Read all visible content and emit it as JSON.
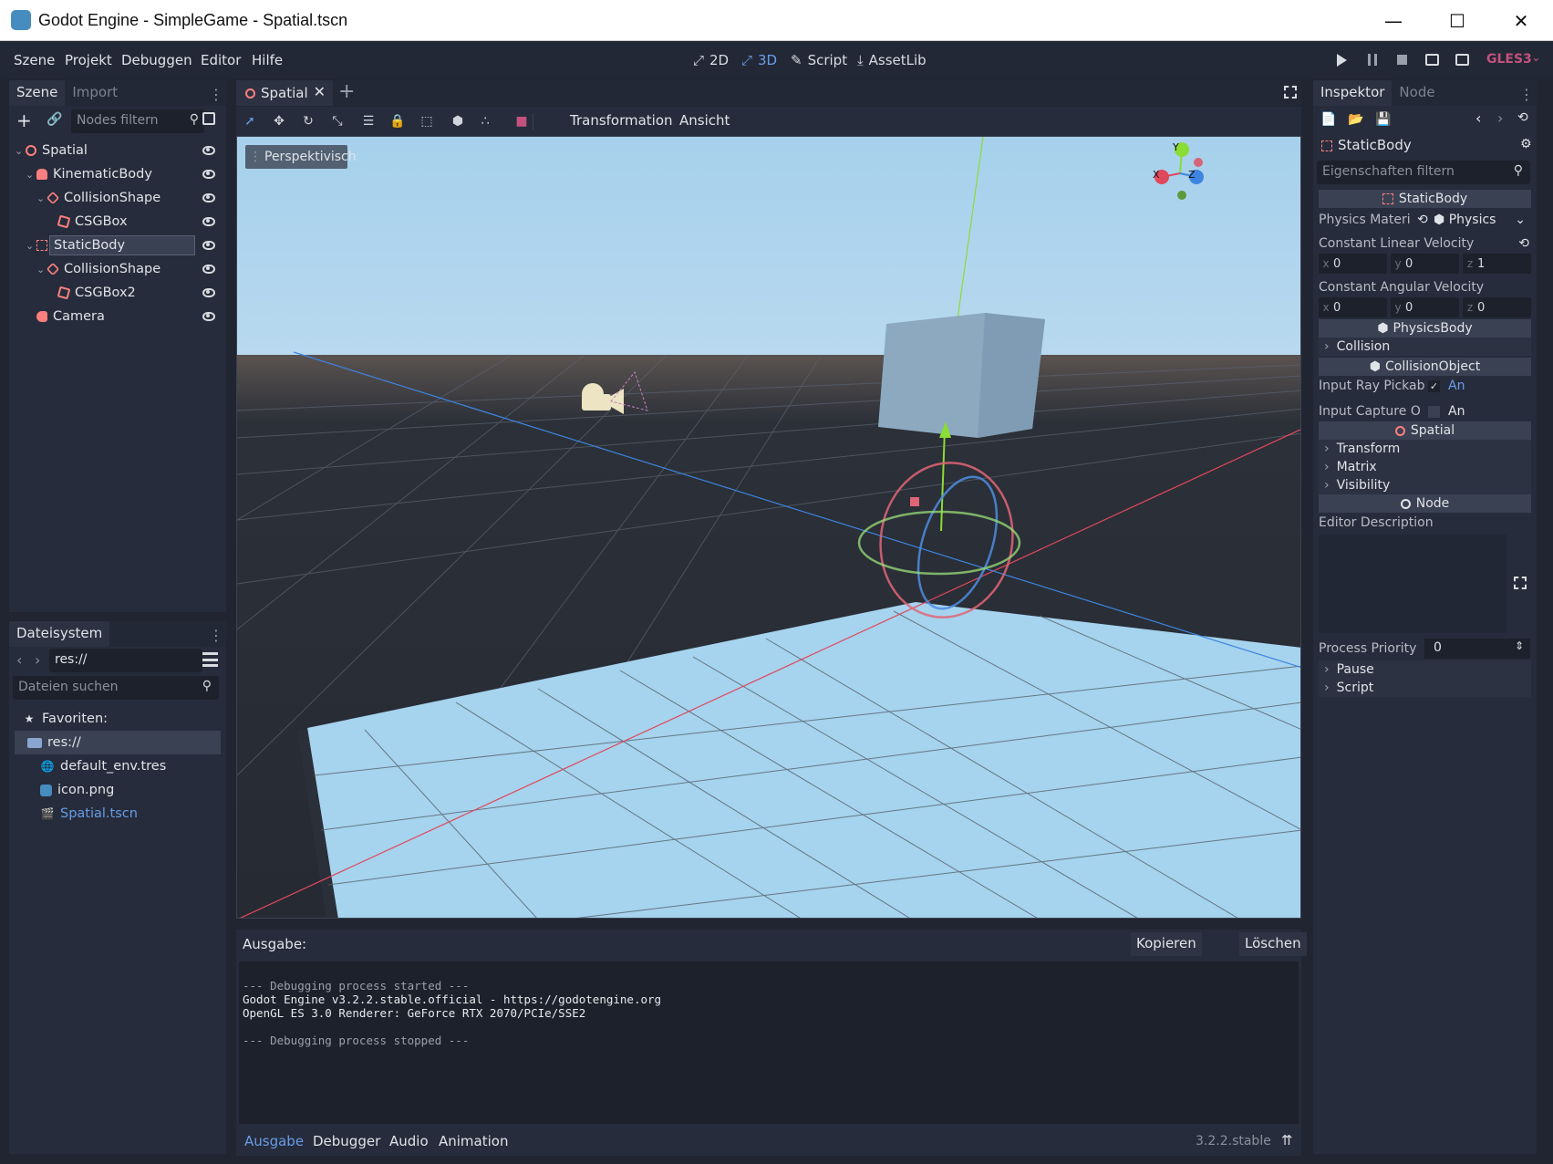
{
  "window": {
    "title": "Godot Engine - SimpleGame - Spatial.tscn",
    "min": "—",
    "max": "☐",
    "close": "✕"
  },
  "menu": [
    "Szene",
    "Projekt",
    "Debuggen",
    "Editor",
    "Hilfe"
  ],
  "workspaces": [
    {
      "label": "2D",
      "icon": "⤢"
    },
    {
      "label": "3D",
      "icon": "⤢"
    },
    {
      "label": "Script",
      "icon": "✎"
    },
    {
      "label": "AssetLib",
      "icon": "⤓"
    }
  ],
  "renderer": "GLES3",
  "scene_panel": {
    "tabs": [
      "Szene",
      "Import"
    ],
    "filter_placeholder": "Nodes filtern",
    "tree": [
      {
        "label": "Spatial",
        "indent": 0,
        "icon": "ring",
        "arrow": "⌄"
      },
      {
        "label": "KinematicBody",
        "indent": 1,
        "icon": "kin",
        "arrow": "⌄"
      },
      {
        "label": "CollisionShape",
        "indent": 2,
        "icon": "hex",
        "arrow": "⌄"
      },
      {
        "label": "CSGBox",
        "indent": 3,
        "icon": "csg",
        "arrow": ""
      },
      {
        "label": "StaticBody",
        "indent": 1,
        "icon": "box",
        "arrow": "⌄",
        "selected": true
      },
      {
        "label": "CollisionShape",
        "indent": 2,
        "icon": "hex",
        "arrow": "⌄"
      },
      {
        "label": "CSGBox2",
        "indent": 3,
        "icon": "csg",
        "arrow": ""
      },
      {
        "label": "Camera",
        "indent": 1,
        "icon": "cam",
        "arrow": ""
      }
    ]
  },
  "filesystem": {
    "tab": "Dateisystem",
    "path": "res://",
    "search_placeholder": "Dateien suchen",
    "items": [
      {
        "label": "Favoriten:",
        "indent": 0,
        "icon": "★"
      },
      {
        "label": "res://",
        "indent": 0,
        "icon": "folder",
        "selected": true
      },
      {
        "label": "default_env.tres",
        "indent": 1,
        "icon": "🌐"
      },
      {
        "label": "icon.png",
        "indent": 1,
        "icon": "img"
      },
      {
        "label": "Spatial.tscn",
        "indent": 1,
        "icon": "🎬",
        "link": true
      }
    ]
  },
  "editor": {
    "scene_tab": "Spatial",
    "toolbar_menus": [
      "Transformation",
      "Ansicht"
    ],
    "viewport_label": "Perspektivisch",
    "gizmo": {
      "y": "Y",
      "x": "X",
      "z": "Z"
    }
  },
  "output": {
    "title": "Ausgabe:",
    "copy": "Kopieren",
    "clear": "Löschen",
    "lines": [
      "",
      "--- Debugging process started ---",
      "Godot Engine v3.2.2.stable.official - https://godotengine.org",
      "OpenGL ES 3.0 Renderer: GeForce RTX 2070/PCIe/SSE2",
      "",
      "--- Debugging process stopped ---"
    ]
  },
  "bottom_tabs": [
    "Ausgabe",
    "Debugger",
    "Audio",
    "Animation"
  ],
  "version": "3.2.2.stable",
  "inspector": {
    "tabs": [
      "Inspektor",
      "Node"
    ],
    "node_name": "StaticBody",
    "filter_placeholder": "Eigenschaften filtern",
    "sec_staticbody": "StaticBody",
    "physics_material_label": "Physics Materi",
    "physics_material_value": "Physics",
    "const_linear": "Constant Linear Velocity",
    "linear": {
      "x": "0",
      "y": "0",
      "z": "1"
    },
    "const_angular": "Constant Angular Velocity",
    "angular": {
      "x": "0",
      "y": "0",
      "z": "0"
    },
    "sec_physicsbody": "PhysicsBody",
    "collision": "Collision",
    "sec_collisionobject": "CollisionObject",
    "input_ray_label": "Input Ray Pickab",
    "input_ray_value": "An",
    "input_capture_label": "Input Capture O",
    "input_capture_value": "An",
    "sec_spatial": "Spatial",
    "transform": "Transform",
    "matrix": "Matrix",
    "visibility": "Visibility",
    "sec_node": "Node",
    "editor_description": "Editor Description",
    "process_priority_label": "Process Priority",
    "process_priority_value": "0",
    "pause": "Pause",
    "script": "Script"
  },
  "colors": {
    "accent": "#699ce8",
    "bg": "#202531",
    "panel": "#262c3b",
    "sky": "#a6cfea",
    "red_icon": "#fc7f7f"
  }
}
